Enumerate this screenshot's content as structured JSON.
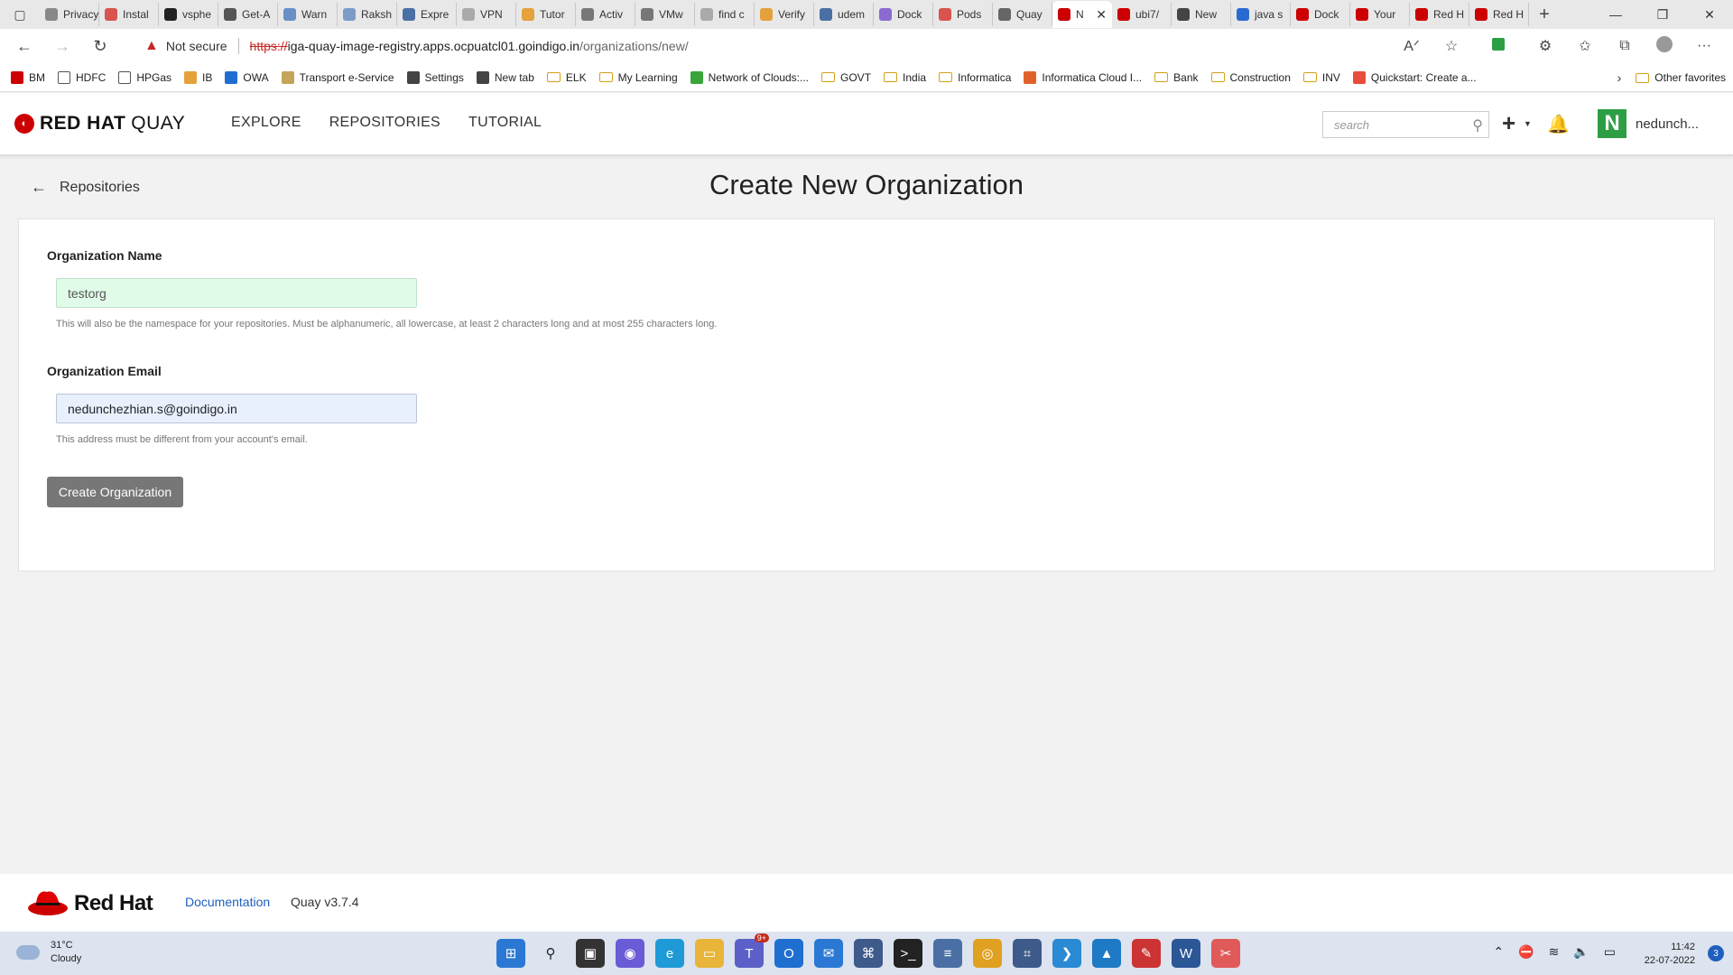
{
  "browser": {
    "tabs": [
      {
        "label": "Privacy err",
        "color": "#888"
      },
      {
        "label": "Instal",
        "color": "#d9534f"
      },
      {
        "label": "vsphe",
        "color": "#222"
      },
      {
        "label": "Get-A",
        "color": "#555"
      },
      {
        "label": "Warn",
        "color": "#6a8fc7"
      },
      {
        "label": "Raksh",
        "color": "#7a9cc6"
      },
      {
        "label": "Expre",
        "color": "#4a6fa5"
      },
      {
        "label": "VPN",
        "color": "#aaa"
      },
      {
        "label": "Tutor",
        "color": "#e5a13b"
      },
      {
        "label": "Activ",
        "color": "#777"
      },
      {
        "label": "VMw",
        "color": "#777"
      },
      {
        "label": "find c",
        "color": "#aaa"
      },
      {
        "label": "Verify",
        "color": "#e5a13b"
      },
      {
        "label": "udem",
        "color": "#4a6fa5"
      },
      {
        "label": "Dock",
        "color": "#8a6bd1"
      },
      {
        "label": "Pods",
        "color": "#d9534f"
      },
      {
        "label": "Quay",
        "color": "#666"
      },
      {
        "label": "N",
        "color": "#cc0000"
      },
      {
        "label": "ubi7/",
        "color": "#cc0000"
      },
      {
        "label": "New",
        "color": "#444"
      },
      {
        "label": "java s",
        "color": "#2a6bd1"
      },
      {
        "label": "Dock",
        "color": "#cc0000"
      },
      {
        "label": "Your",
        "color": "#cc0000"
      },
      {
        "label": "Red H",
        "color": "#cc0000"
      },
      {
        "label": "Red H",
        "color": "#cc0000"
      }
    ],
    "active_tab_index": 17,
    "not_secure": "Not secure",
    "url_scheme": "https://",
    "url_host": "iga-quay-image-registry.apps.ocpuatcl01.goindigo.in",
    "url_path": "/organizations/new/",
    "bookmarks": [
      {
        "label": "BM",
        "kind": "icon",
        "color": "#cc0000"
      },
      {
        "label": "HDFC",
        "kind": "page",
        "color": "#555"
      },
      {
        "label": "HPGas",
        "kind": "page",
        "color": "#555"
      },
      {
        "label": "IB",
        "kind": "icon",
        "color": "#e5a13b"
      },
      {
        "label": "OWA",
        "kind": "icon",
        "color": "#1f6fd1"
      },
      {
        "label": "Transport e-Service",
        "kind": "icon",
        "color": "#c4a35a"
      },
      {
        "label": "Settings",
        "kind": "icon",
        "color": "#444"
      },
      {
        "label": "New tab",
        "kind": "icon",
        "color": "#444"
      },
      {
        "label": "ELK",
        "kind": "folder",
        "color": "#d4a017"
      },
      {
        "label": "My Learning",
        "kind": "folder",
        "color": "#d4a017"
      },
      {
        "label": "Network of Clouds:...",
        "kind": "icon",
        "color": "#3aa53a"
      },
      {
        "label": "GOVT",
        "kind": "folder",
        "color": "#d4a017"
      },
      {
        "label": "India",
        "kind": "folder",
        "color": "#d4a017"
      },
      {
        "label": "Informatica",
        "kind": "folder",
        "color": "#d4a017"
      },
      {
        "label": "Informatica Cloud I...",
        "kind": "icon",
        "color": "#e0622a"
      },
      {
        "label": "Bank",
        "kind": "folder",
        "color": "#d4a017"
      },
      {
        "label": "Construction",
        "kind": "folder",
        "color": "#d4a017"
      },
      {
        "label": "INV",
        "kind": "folder",
        "color": "#d4a017"
      },
      {
        "label": "Quickstart: Create a...",
        "kind": "icon",
        "color": "#e74c3c"
      }
    ],
    "other_favorites": "Other favorites"
  },
  "header": {
    "logo_redhat": "RED HAT",
    "logo_quay": "QUAY",
    "nav": [
      "EXPLORE",
      "REPOSITORIES",
      "TUTORIAL"
    ],
    "search_placeholder": "search",
    "avatar_letter": "N",
    "username": "nedunch...",
    "avatar_color": "#2e9e44"
  },
  "page": {
    "back_label": "Repositories",
    "title": "Create New Organization",
    "org_name_label": "Organization Name",
    "org_name_value": "testorg",
    "org_name_help": "This will also be the namespace for your repositories. Must be alphanumeric, all lowercase, at least 2 characters long and at most 255 characters long.",
    "org_email_label": "Organization Email",
    "org_email_value": "nedunchezhian.s@goindigo.in",
    "org_email_help": "This address must be different from your account's email.",
    "submit_label": "Create Organization"
  },
  "footer": {
    "brand": "Red Hat",
    "doc_link": "Documentation",
    "version": "Quay v3.7.4"
  },
  "taskbar": {
    "temperature": "31°C",
    "condition": "Cloudy",
    "time": "11:42",
    "date": "22-07-2022",
    "notifications": "3",
    "teams_badge": "9+"
  }
}
